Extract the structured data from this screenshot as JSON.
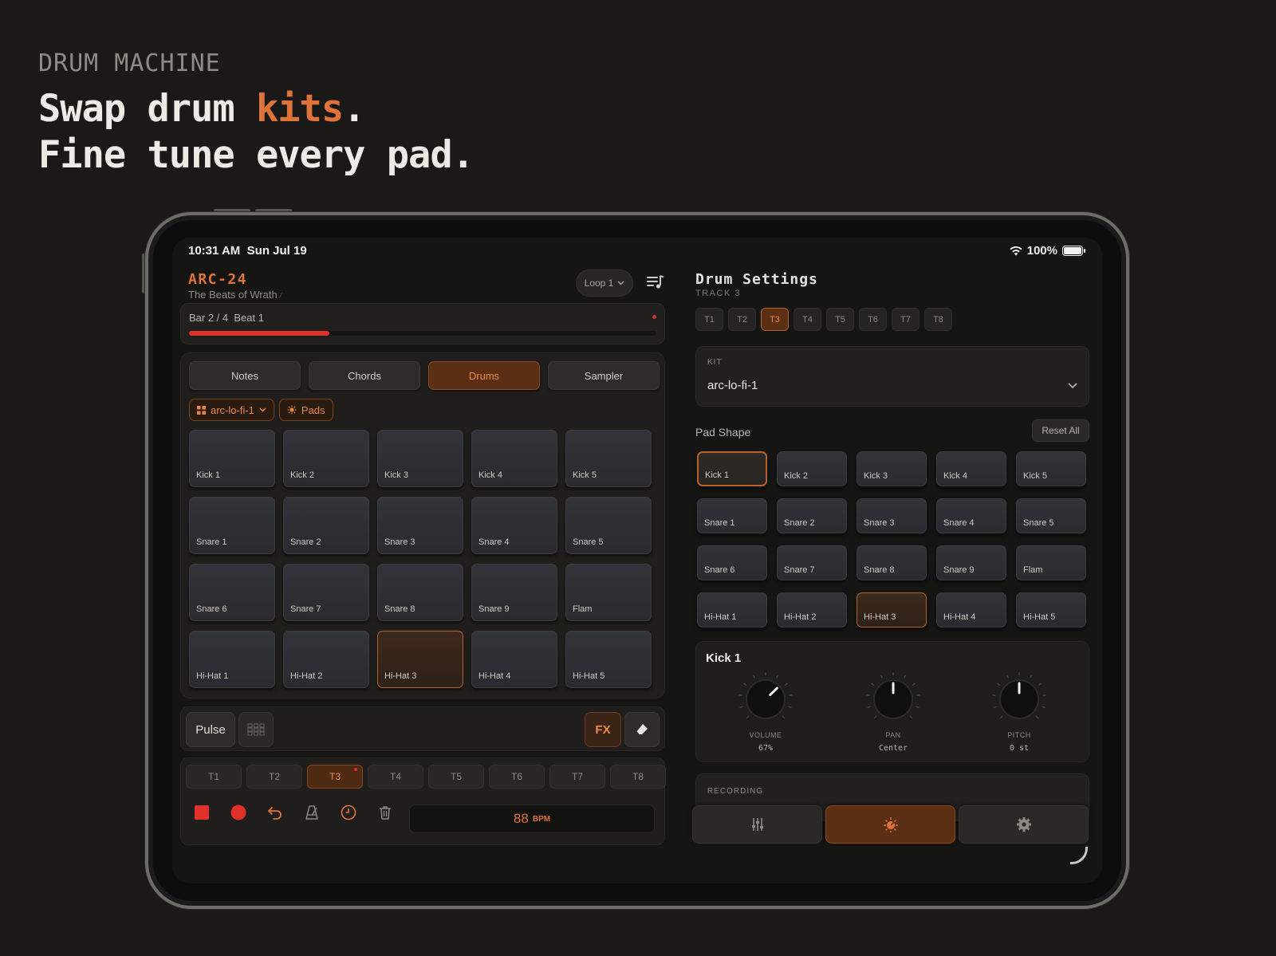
{
  "promo": {
    "eyebrow": "DRUM MACHINE",
    "line1_a": "Swap drum ",
    "line1_accent": "kits",
    "line1_b": ".",
    "line2": "Fine tune every pad."
  },
  "status": {
    "time": "10:31 AM",
    "date": "Sun Jul 19",
    "battery": "100%"
  },
  "app": {
    "name": "ARC-24",
    "subtitle": "The Beats of Wrath"
  },
  "loop": {
    "label": "Loop 1"
  },
  "progress": {
    "label": "Bar 2 / 4  Beat 1",
    "fraction": 0.3
  },
  "tabs": [
    {
      "label": "Notes"
    },
    {
      "label": "Chords"
    },
    {
      "label": "Drums",
      "active": true
    },
    {
      "label": "Sampler"
    }
  ],
  "chips": {
    "kit": "arc-lo-fi-1",
    "mode": "Pads"
  },
  "pads": [
    "Kick 1",
    "Kick 2",
    "Kick 3",
    "Kick 4",
    "Kick 5",
    "Snare 1",
    "Snare 2",
    "Snare 3",
    "Snare 4",
    "Snare 5",
    "Snare 6",
    "Snare 7",
    "Snare 8",
    "Snare 9",
    "Flam",
    "Hi-Hat 1",
    "Hi-Hat 2",
    "Hi-Hat 3",
    "Hi-Hat 4",
    "Hi-Hat 5"
  ],
  "active_pad": "Hi-Hat 3",
  "toolbar": {
    "pulse": "Pulse",
    "fx": "FX"
  },
  "tracks": [
    "T1",
    "T2",
    "T3",
    "T4",
    "T5",
    "T6",
    "T7",
    "T8"
  ],
  "active_track": "T3",
  "bpm": {
    "value": "88",
    "unit": "BPM"
  },
  "drum_settings": {
    "title": "Drum Settings",
    "track": "TRACK 3",
    "kit_label": "KIT",
    "kit_value": "arc-lo-fi-1",
    "pad_shape_label": "Pad Shape",
    "reset_label": "Reset All",
    "selected_pad": "Kick 1",
    "knob_title": "Kick 1",
    "knobs": [
      {
        "label": "VOLUME",
        "value": "67%",
        "level": 0.67
      },
      {
        "label": "PAN",
        "value": "Center",
        "level": 0.5
      },
      {
        "label": "PITCH",
        "value": "0 st",
        "level": 0.5
      }
    ],
    "recording_label": "RECORDING"
  },
  "colors": {
    "accent": "#e0733a",
    "record": "#e0302c",
    "background": "#1a1918"
  },
  "icons": {
    "loop": "chevron-down-icon",
    "playlist": "playlist-icon",
    "stop": "stop-icon",
    "record": "record-icon",
    "undo": "undo-icon",
    "metronome": "metronome-icon",
    "clock": "clock-icon",
    "trash": "trash-icon",
    "mixer": "sliders-icon",
    "drum": "drum-icon",
    "settings": "gear-icon"
  }
}
